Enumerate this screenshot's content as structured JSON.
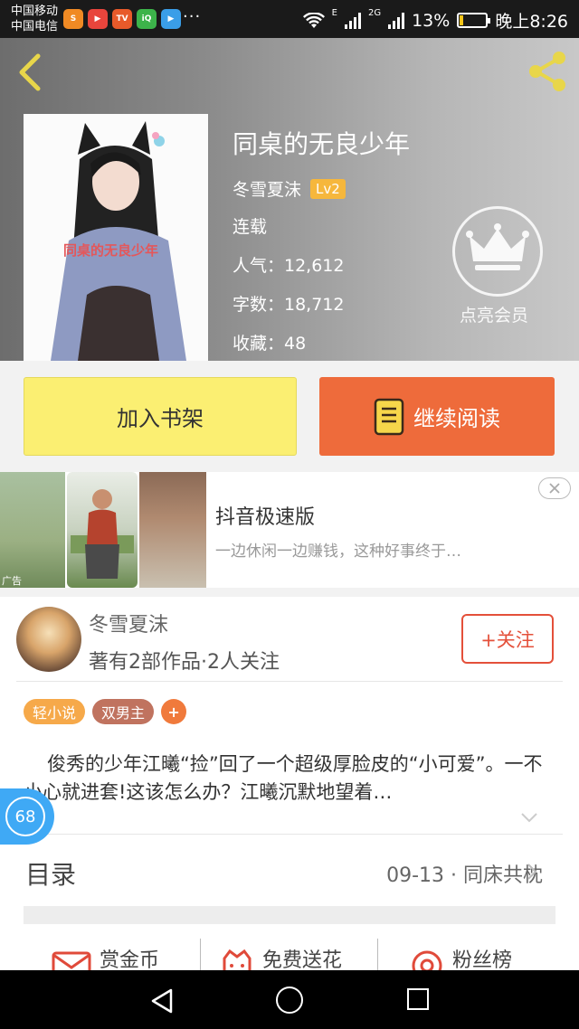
{
  "status_bar": {
    "carrier1": "中国移动",
    "carrier2": "中国电信",
    "network1": "E",
    "network2": "2G",
    "battery": "13%",
    "battery_level": 0.13,
    "time": "晚上8:26",
    "more": "···"
  },
  "book": {
    "title": "同桌的无良少年",
    "author": "冬雪夏沫",
    "level": "Lv2",
    "status": "连载",
    "popularity": "人气：12,612",
    "word_count": "字数：18,712",
    "favorites": "收藏：48",
    "cover_caption": "同桌的无良少年"
  },
  "vip": {
    "label": "点亮会员"
  },
  "actions": {
    "add_shelf": "加入书架",
    "continue_read": "继续阅读"
  },
  "ad": {
    "title": "抖音极速版",
    "desc": "一边休闲一边赚钱，这种好事终于…",
    "tag": "广告"
  },
  "author_card": {
    "name": "冬雪夏沫",
    "stats": "著有2部作品·2人关注",
    "follow": "+关注"
  },
  "tags": [
    {
      "label": "轻小说",
      "color": "#f6a94a"
    },
    {
      "label": "双男主",
      "color": "#c0735f"
    },
    {
      "label": "+",
      "color": "#f07a3c"
    }
  ],
  "intro": "俊秀的少年江曦“捡”回了一个超级厚脸皮的“小可爱”。一不小心就进套!这该怎么办？江曦沉默地望着…",
  "floating_badge": "68",
  "toc": {
    "label": "目录",
    "latest": "09-13 · 同床共枕"
  },
  "bottom_actions": {
    "reward": "赏金币",
    "flowers": "免费送花",
    "fans": "粉丝榜"
  },
  "colors": {
    "accent_orange": "#ee6b3b",
    "shelf_yellow": "#fbef72",
    "badge_blue": "#3fa9f5",
    "follow_red": "#e4503a"
  }
}
